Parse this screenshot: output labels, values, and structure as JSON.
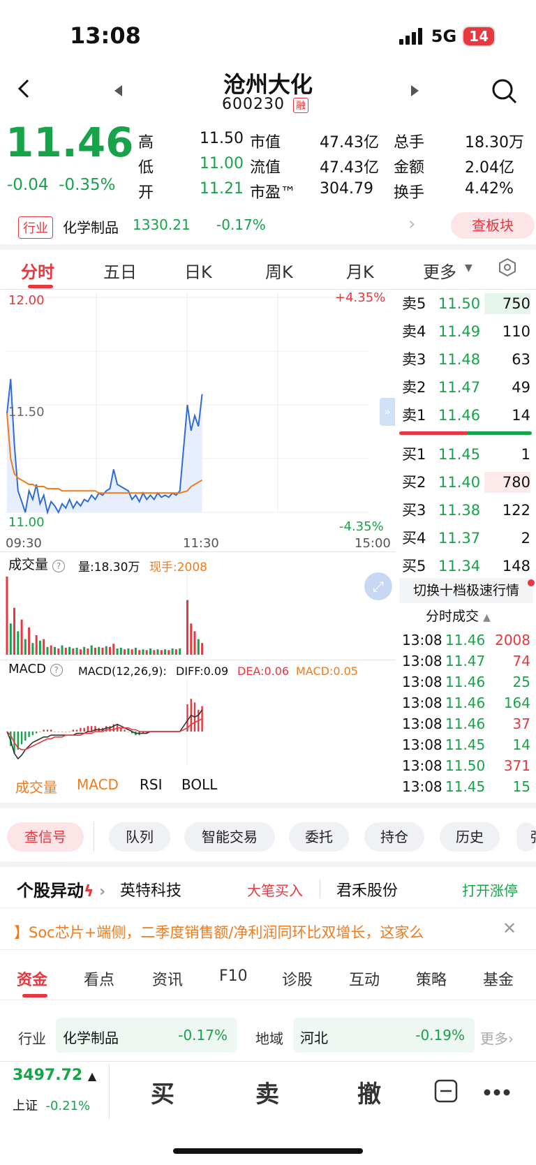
{
  "status": {
    "time": "13:08",
    "network": "5G",
    "battery": "14"
  },
  "header": {
    "name": "沧州大化",
    "code": "600230",
    "badge": "融"
  },
  "quote": {
    "price": "11.46",
    "change": "-0.04",
    "change_pct": "-0.35%",
    "stats": [
      {
        "k1": "高",
        "v1": "11.50",
        "k2": "市值",
        "v2": "47.43亿",
        "k3": "总手",
        "v3": "18.30万"
      },
      {
        "k1": "低",
        "v1": "11.00",
        "k2": "流值",
        "v2": "47.43亿",
        "k3": "金额",
        "v3": "2.04亿"
      },
      {
        "k1": "开",
        "v1": "11.21",
        "k2": "市盈™",
        "v2": "304.79",
        "k3": "换手",
        "v3": "4.42%"
      }
    ]
  },
  "industry": {
    "tag": "行业",
    "name": "化学制品",
    "value": "1330.21",
    "pct": "-0.17%",
    "button": "查板块"
  },
  "chart_tabs": [
    "分时",
    "五日",
    "日K",
    "周K",
    "月K",
    "更多"
  ],
  "chart_labels": {
    "top_price": "12.00",
    "mid_price": "11.50",
    "low_price": "11.00",
    "top_pct": "+4.35%",
    "low_pct": "-4.35%",
    "t_start": "09:30",
    "t_mid": "11:30",
    "t_end": "15:00",
    "vol_title": "成交量",
    "vol_amount": "量:18.30万",
    "vol_now": "现手:2008",
    "macd_title": "MACD",
    "macd_params": "MACD(12,26,9):",
    "diff": "DIFF:0.09",
    "dea": "DEA:0.06",
    "macd": "MACD:0.05"
  },
  "orderbook": {
    "sell": [
      {
        "label": "卖5",
        "price": "11.50",
        "vol": "750"
      },
      {
        "label": "卖4",
        "price": "11.49",
        "vol": "110"
      },
      {
        "label": "卖3",
        "price": "11.48",
        "vol": "63"
      },
      {
        "label": "卖2",
        "price": "11.47",
        "vol": "49"
      },
      {
        "label": "卖1",
        "price": "11.46",
        "vol": "14"
      }
    ],
    "buy": [
      {
        "label": "买1",
        "price": "11.45",
        "vol": "1"
      },
      {
        "label": "买2",
        "price": "11.40",
        "vol": "780"
      },
      {
        "label": "买3",
        "price": "11.38",
        "vol": "122"
      },
      {
        "label": "买4",
        "price": "11.37",
        "vol": "2"
      },
      {
        "label": "买5",
        "price": "11.34",
        "vol": "148"
      }
    ],
    "switch_label": "切换十档极速行情",
    "ticks_title": "分时成交"
  },
  "ticks": [
    {
      "t": "13:08",
      "p": "11.46",
      "v": "2008",
      "pc": "green",
      "vc": "red"
    },
    {
      "t": "13:08",
      "p": "11.47",
      "v": "74",
      "pc": "green",
      "vc": "red"
    },
    {
      "t": "13:08",
      "p": "11.46",
      "v": "25",
      "pc": "green",
      "vc": "green"
    },
    {
      "t": "13:08",
      "p": "11.46",
      "v": "164",
      "pc": "green",
      "vc": "green"
    },
    {
      "t": "13:08",
      "p": "11.46",
      "v": "37",
      "pc": "green",
      "vc": "red"
    },
    {
      "t": "13:08",
      "p": "11.45",
      "v": "14",
      "pc": "green",
      "vc": "green"
    },
    {
      "t": "13:08",
      "p": "11.50",
      "v": "371",
      "pc": "green",
      "vc": "red"
    },
    {
      "t": "13:08",
      "p": "11.45",
      "v": "15",
      "pc": "green",
      "vc": "green"
    }
  ],
  "indicator_tabs": [
    "成交量",
    "MACD",
    "RSI",
    "BOLL"
  ],
  "actions": [
    "查信号",
    "队列",
    "智能交易",
    "委托",
    "持仓",
    "历史",
    "强"
  ],
  "yidong": {
    "title": "个股异动",
    "a": "英特科技",
    "a_tag": "大笔买入",
    "b": "君禾股份",
    "b_tag": "打开涨停"
  },
  "headline": "】Soc芯片+端侧，二季度销售额/净利润同环比双增长，这家么",
  "bottom_tabs": [
    "资金",
    "看点",
    "资讯",
    "F10",
    "诊股",
    "互动",
    "策略",
    "基金"
  ],
  "sectors": {
    "ind_label": "行业",
    "ind_name": "化学制品",
    "ind_pct": "-0.17%",
    "reg_label": "地域",
    "reg_name": "河北",
    "reg_pct": "-0.19%",
    "more": "更多"
  },
  "bottom_bar": {
    "index": "3497.72",
    "index_name": "上证",
    "index_pct": "-0.21%",
    "buy": "买",
    "sell": "卖",
    "cancel": "撤"
  },
  "chart_data": {
    "type": "line",
    "price_axis": [
      11.0,
      12.0
    ],
    "pct_axis": [
      "-4.35%",
      "+4.35%"
    ],
    "x": [
      "09:30",
      "11:30",
      "15:00"
    ],
    "price": [
      11.46,
      11.62,
      11.32,
      11.1,
      11.05,
      11.0,
      11.1,
      11.06,
      11.13,
      11.04,
      11.08,
      11.0,
      11.05,
      11.03,
      11.0,
      11.04,
      11.02,
      11.06,
      11.02,
      11.05,
      11.03,
      11.06,
      11.05,
      11.08,
      11.06,
      11.09,
      11.08,
      11.1,
      11.11,
      11.2,
      11.13,
      11.12,
      11.11,
      11.1,
      11.06,
      11.08,
      11.05,
      11.09,
      11.06,
      11.08,
      11.06,
      11.09,
      11.07,
      11.08,
      11.07,
      11.09,
      11.08,
      11.1,
      11.5,
      11.38,
      11.45,
      11.4,
      11.55
    ],
    "avg": [
      11.46,
      11.25,
      11.18,
      11.16,
      11.15,
      11.14,
      11.13,
      11.13,
      11.12,
      11.12,
      11.12,
      11.11,
      11.11,
      11.11,
      11.11,
      11.1,
      11.1,
      11.1,
      11.1,
      11.1,
      11.1,
      11.1,
      11.1,
      11.1,
      11.1,
      11.09,
      11.09,
      11.09,
      11.09,
      11.09,
      11.09,
      11.09,
      11.09,
      11.09,
      11.09,
      11.09,
      11.09,
      11.09,
      11.09,
      11.09,
      11.09,
      11.09,
      11.09,
      11.09,
      11.09,
      11.09,
      11.09,
      11.09,
      11.1,
      11.12,
      11.13,
      11.14,
      11.15
    ],
    "volume": [
      100,
      40,
      60,
      30,
      45,
      20,
      35,
      15,
      25,
      18,
      20,
      10,
      12,
      10,
      8,
      12,
      9,
      10,
      8,
      9,
      7,
      10,
      8,
      12,
      9,
      10,
      9,
      11,
      10,
      14,
      8,
      9,
      7,
      8,
      7,
      9,
      6,
      7,
      6,
      8,
      6,
      7,
      6,
      7,
      6,
      8,
      7,
      8,
      70,
      40,
      30,
      20,
      15
    ],
    "volume_up": [
      1,
      0,
      1,
      0,
      1,
      0,
      1,
      0,
      1,
      0,
      1,
      0,
      1,
      0,
      1,
      0,
      1,
      0,
      1,
      0,
      1,
      0,
      1,
      0,
      1,
      0,
      1,
      0,
      1,
      1,
      0,
      0,
      1,
      0,
      1,
      0,
      1,
      0,
      1,
      0,
      1,
      0,
      1,
      0,
      1,
      0,
      1,
      0,
      1,
      1,
      1,
      0,
      1
    ],
    "macd_hist": [
      0,
      -0.08,
      -0.12,
      -0.1,
      -0.07,
      -0.05,
      -0.03,
      -0.02,
      -0.01,
      0,
      0.01,
      0.01,
      0.01,
      0.0,
      0.0,
      0.0,
      0.0,
      0.0,
      0.01,
      0.01,
      0.02,
      0.02,
      0.03,
      0.03,
      0.03,
      0.02,
      0.02,
      0.03,
      0.03,
      0.04,
      0.04,
      0.02,
      0.01,
      0.0,
      -0.01,
      -0.02,
      -0.02,
      -0.01,
      -0.01,
      0,
      0,
      0,
      0,
      0,
      0,
      0,
      0,
      0,
      0.15,
      0.18,
      0.16,
      0.12,
      0.14
    ],
    "diff": [
      0,
      -0.05,
      -0.12,
      -0.15,
      -0.13,
      -0.1,
      -0.08,
      -0.06,
      -0.05,
      -0.04,
      -0.03,
      -0.03,
      -0.02,
      -0.02,
      -0.02,
      -0.02,
      -0.02,
      -0.02,
      -0.02,
      -0.01,
      -0.01,
      -0.01,
      0,
      0,
      0.01,
      0.01,
      0.01,
      0.02,
      0.02,
      0.03,
      0.04,
      0.03,
      0.02,
      0.01,
      0,
      -0.01,
      -0.01,
      -0.01,
      -0.01,
      0,
      0,
      0,
      0,
      0,
      0,
      0,
      0,
      0,
      0.06,
      0.09,
      0.08,
      0.09,
      0.12
    ],
    "dea": [
      0,
      -0.02,
      -0.06,
      -0.09,
      -0.1,
      -0.1,
      -0.09,
      -0.08,
      -0.07,
      -0.06,
      -0.05,
      -0.04,
      -0.04,
      -0.03,
      -0.03,
      -0.03,
      -0.02,
      -0.02,
      -0.02,
      -0.02,
      -0.02,
      -0.01,
      -0.01,
      -0.01,
      0,
      0,
      0,
      0.01,
      0.01,
      0.01,
      0.02,
      0.02,
      0.02,
      0.02,
      0.01,
      0.01,
      0,
      0,
      0,
      0,
      0,
      0,
      0,
      0,
      0,
      0,
      0,
      0,
      0.02,
      0.04,
      0.05,
      0.06,
      0.07
    ]
  }
}
